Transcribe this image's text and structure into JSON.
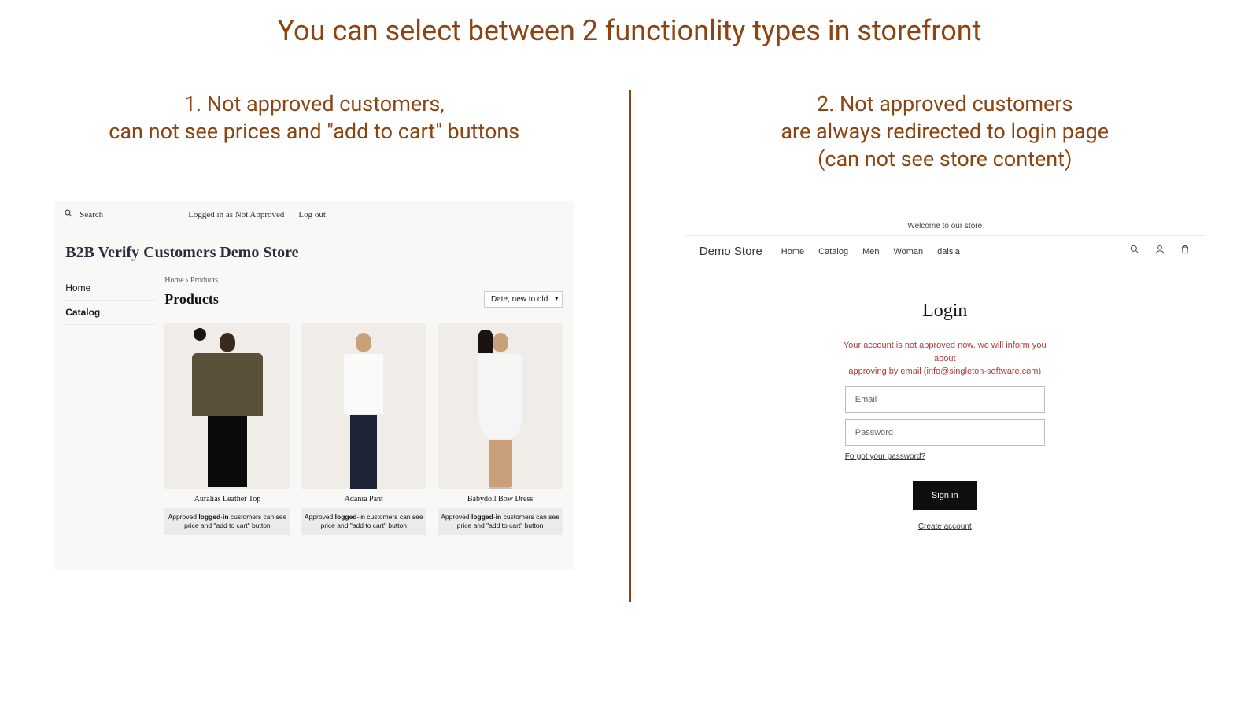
{
  "page_title": "You can select between 2 functionlity types in storefront",
  "option1": {
    "line1": "1. Not approved customers,",
    "line2": "can not see prices and \"add to cart\" buttons"
  },
  "option2": {
    "line1": "2. Not approved customers",
    "line2": "are always redirected to login page",
    "line3": "(can not see store content)"
  },
  "left": {
    "search_label": "Search",
    "logged_in_status": "Logged in as Not Approved",
    "logout": "Log out",
    "store_name": "B2B Verify Customers Demo Store",
    "side": {
      "home": "Home",
      "catalog": "Catalog"
    },
    "breadcrumb_home": "Home",
    "breadcrumb_sep": "›",
    "breadcrumb_products": "Products",
    "heading": "Products",
    "sort_selected": "Date, new to old",
    "products": [
      {
        "name": "Auralias Leather Top"
      },
      {
        "name": "Adania Pant"
      },
      {
        "name": "Babydoll Bow Dress"
      }
    ],
    "note_prefix": "Approved ",
    "note_bold": "logged-in",
    "note_suffix": " customers can see price and \"add to cart\" button"
  },
  "right": {
    "banner": "Welcome to our store",
    "logo": "Demo Store",
    "nav": {
      "home": "Home",
      "catalog": "Catalog",
      "men": "Men",
      "woman": "Woman",
      "dalsia": "dalsia"
    },
    "login_title": "Login",
    "warn_line1": "Your account is not approved now, we will inform you about",
    "warn_line2": "approving by email (info@singleton-software.com)",
    "email_placeholder": "Email",
    "password_placeholder": "Password",
    "forgot": "Forgot your password?",
    "signin": "Sign in",
    "create": "Create account"
  }
}
